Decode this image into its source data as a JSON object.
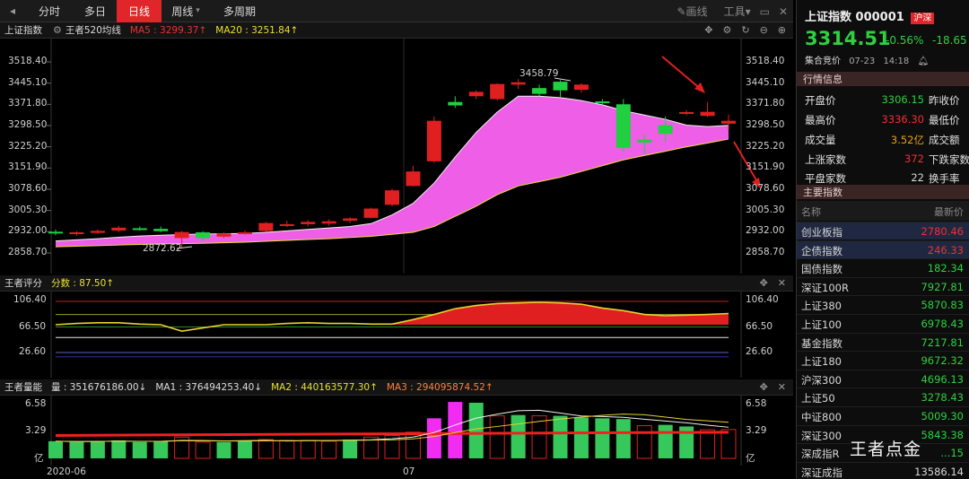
{
  "toolbar": {
    "periods": [
      "分时",
      "多日",
      "日线",
      "周线",
      "多周期"
    ],
    "active_index": 2,
    "draw": "画线",
    "tools": "工具"
  },
  "main_panel": {
    "name": "上证指数",
    "indicator": "王者520均线",
    "ma5": "MA5 : 3299.37↑",
    "ma20": "MA20 : 3251.84↑",
    "y_ticks": [
      "3518.40",
      "3445.10",
      "3371.80",
      "3298.50",
      "3225.20",
      "3151.90",
      "3078.60",
      "3005.30",
      "2932.00",
      "2858.70"
    ],
    "high_label": "3458.79",
    "low_label": "2872.62"
  },
  "score_panel": {
    "name": "王者评分",
    "score": "分数 : 87.50↑",
    "y_ticks": [
      "106.40",
      "66.50",
      "26.60"
    ]
  },
  "volume_panel": {
    "name": "王者量能",
    "vol": "量 : 351676186.00↓",
    "ma1": "MA1 : 376494253.40↓",
    "ma2": "MA2 : 440163577.30↑",
    "ma3": "MA3 : 294095874.52↑",
    "y_ticks": [
      "6.58",
      "3.29",
      "亿"
    ]
  },
  "x_axis": {
    "labels": [
      "2020-06",
      "07"
    ]
  },
  "quote": {
    "title": "上证指数 000001",
    "market_tag": "沪深",
    "price": "3314.51",
    "pct": "-0.56%",
    "chg": "-18.65",
    "session": "集合竞价",
    "date": "07-23",
    "time": "14:18"
  },
  "info": {
    "header": "行情信息",
    "open_label": "开盘价",
    "open": "3306.15",
    "prev_label": "昨收价",
    "high_label": "最高价",
    "high": "3336.30",
    "low_label": "最低价",
    "vol_label": "成交量",
    "vol": "3.52亿",
    "amount_label": "成交额",
    "up_label": "上涨家数",
    "up": "372",
    "down_label": "下跌家数",
    "flat_label": "平盘家数",
    "flat": "22",
    "turnover_label": "换手率"
  },
  "indices": {
    "header": "主要指数",
    "col_name": "名称",
    "col_price": "最新价",
    "rows": [
      {
        "name": "创业板指",
        "price": "2780.46",
        "color": "#f03030"
      },
      {
        "name": "企债指数",
        "price": "246.33",
        "color": "#f03030"
      },
      {
        "name": "国债指数",
        "price": "182.34",
        "color": "#2ed040"
      },
      {
        "name": "深证100R",
        "price": "7927.81",
        "color": "#2ed040"
      },
      {
        "name": "上证380",
        "price": "5870.83",
        "color": "#2ed040"
      },
      {
        "name": "上证100",
        "price": "6978.43",
        "color": "#2ed040"
      },
      {
        "name": "基金指数",
        "price": "7217.81",
        "color": "#2ed040"
      },
      {
        "name": "上证180",
        "price": "9672.32",
        "color": "#2ed040"
      },
      {
        "name": "沪深300",
        "price": "4696.13",
        "color": "#2ed040"
      },
      {
        "name": "上证50",
        "price": "3278.43",
        "color": "#2ed040"
      },
      {
        "name": "中证800",
        "price": "5009.30",
        "color": "#2ed040"
      },
      {
        "name": "深证300",
        "price": "5843.38",
        "color": "#2ed040"
      },
      {
        "name": "深成指R",
        "price": "...15",
        "color": "#2ed040"
      },
      {
        "name": "深证成指",
        "price": "13586.14",
        "color": "#d8d8d8"
      }
    ]
  },
  "watermark": "王者点金",
  "chart_data": {
    "type": "candlestick",
    "x_start": "2020-06",
    "y_range": [
      2858.7,
      3518.4
    ],
    "candles": [
      [
        2932,
        2940,
        2920,
        2926
      ],
      [
        2926,
        2934,
        2918,
        2930
      ],
      [
        2928,
        2940,
        2924,
        2935
      ],
      [
        2936,
        2952,
        2930,
        2946
      ],
      [
        2944,
        2950,
        2936,
        2940
      ],
      [
        2942,
        2950,
        2930,
        2934
      ],
      [
        2910,
        2935,
        2876,
        2931
      ],
      [
        2930,
        2934,
        2900,
        2910
      ],
      [
        2915,
        2930,
        2910,
        2926
      ],
      [
        2928,
        2936,
        2922,
        2930
      ],
      [
        2935,
        2966,
        2932,
        2962
      ],
      [
        2955,
        2970,
        2948,
        2958
      ],
      [
        2958,
        2972,
        2950,
        2966
      ],
      [
        2960,
        2975,
        2952,
        2968
      ],
      [
        2970,
        2982,
        2962,
        2978
      ],
      [
        2980,
        3015,
        2978,
        3012
      ],
      [
        3025,
        3080,
        3020,
        3075
      ],
      [
        3090,
        3160,
        3088,
        3140
      ],
      [
        3175,
        3330,
        3170,
        3315
      ],
      [
        3380,
        3400,
        3360,
        3368
      ],
      [
        3400,
        3420,
        3390,
        3415
      ],
      [
        3390,
        3445,
        3385,
        3442
      ],
      [
        3440,
        3459,
        3425,
        3448
      ],
      [
        3428,
        3440,
        3400,
        3408
      ],
      [
        3450,
        3455,
        3398,
        3420
      ],
      [
        3422,
        3445,
        3412,
        3440
      ],
      [
        3382,
        3390,
        3370,
        3378
      ],
      [
        3372,
        3390,
        3210,
        3222
      ],
      [
        3250,
        3268,
        3200,
        3240
      ],
      [
        3300,
        3330,
        3242,
        3270
      ],
      [
        3340,
        3352,
        3334,
        3345
      ],
      [
        3332,
        3380,
        3328,
        3346
      ],
      [
        3305,
        3336,
        3285,
        3315
      ]
    ],
    "ma_upper": [
      2900,
      2904,
      2908,
      2913,
      2917,
      2920,
      2922,
      2924,
      2925,
      2926,
      2930,
      2935,
      2940,
      2945,
      2950,
      2960,
      2990,
      3030,
      3100,
      3190,
      3275,
      3345,
      3400,
      3400,
      3395,
      3385,
      3370,
      3350,
      3335,
      3320,
      3300,
      3295,
      3299.37
    ],
    "ma_lower": [
      2880,
      2882,
      2884,
      2886,
      2888,
      2890,
      2891,
      2892,
      2894,
      2896,
      2899,
      2902,
      2905,
      2908,
      2912,
      2916,
      2923,
      2930,
      2950,
      2985,
      3020,
      3060,
      3090,
      3105,
      3120,
      3140,
      3160,
      3180,
      3195,
      3210,
      3225,
      3238,
      3251.84
    ],
    "score": [
      70,
      72,
      73,
      73,
      71,
      70,
      60,
      65,
      70,
      70,
      70,
      72,
      73,
      72,
      72,
      71,
      71,
      78,
      86,
      95,
      100,
      103,
      104,
      105,
      104,
      102,
      96,
      92,
      86,
      84,
      85,
      86,
      87.5
    ],
    "volume": [
      2.1,
      2.0,
      2.1,
      2.2,
      2.0,
      2.1,
      2.6,
      2.0,
      2.0,
      2.1,
      2.3,
      2.2,
      2.2,
      2.1,
      2.3,
      2.6,
      2.8,
      3.2,
      4.9,
      6.9,
      6.8,
      5.2,
      5.3,
      5.2,
      5.2,
      5.0,
      4.9,
      4.8,
      4.0,
      4.1,
      3.9,
      3.5,
      3.52
    ],
    "volume_colors": [
      "g",
      "g",
      "g",
      "g",
      "g",
      "g",
      "r",
      "r",
      "g",
      "g",
      "r",
      "r",
      "r",
      "r",
      "g",
      "r",
      "r",
      "r",
      "m",
      "m",
      "g",
      "r",
      "g",
      "r",
      "g",
      "g",
      "g",
      "g",
      "r",
      "g",
      "g",
      "r",
      "r"
    ]
  }
}
